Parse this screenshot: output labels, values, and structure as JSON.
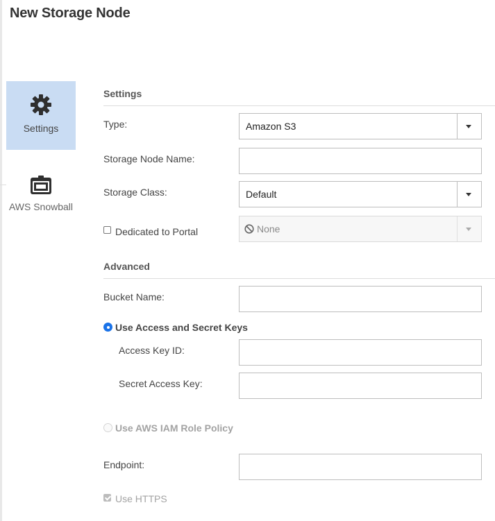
{
  "page": {
    "title": "New Storage Node"
  },
  "nav": {
    "settings": {
      "label": "Settings",
      "icon": "gear-icon"
    },
    "snowball": {
      "label": "AWS Snowball",
      "icon": "snowball-device-icon"
    }
  },
  "settings_section": {
    "title": "Settings",
    "type_label": "Type:",
    "type_value": "Amazon S3",
    "name_label": "Storage Node Name:",
    "name_value": "",
    "class_label": "Storage Class:",
    "class_value": "Default",
    "dedicated_label": "Dedicated to Portal",
    "dedicated_checked": false,
    "portal_value": "None"
  },
  "advanced_section": {
    "title": "Advanced",
    "bucket_label": "Bucket Name:",
    "bucket_value": "",
    "keys_option_label": "Use Access and Secret Keys",
    "keys_option_selected": true,
    "access_key_label": "Access Key ID:",
    "access_key_value": "",
    "secret_key_label": "Secret Access Key:",
    "secret_key_value": "",
    "iam_option_label": "Use AWS IAM Role Policy",
    "iam_option_selected": false,
    "endpoint_label": "Endpoint:",
    "endpoint_value": "",
    "https_label": "Use HTTPS",
    "https_checked": true
  },
  "colors": {
    "nav_selected_bg": "#c9dcf3",
    "radio_accent": "#1a73e8"
  }
}
